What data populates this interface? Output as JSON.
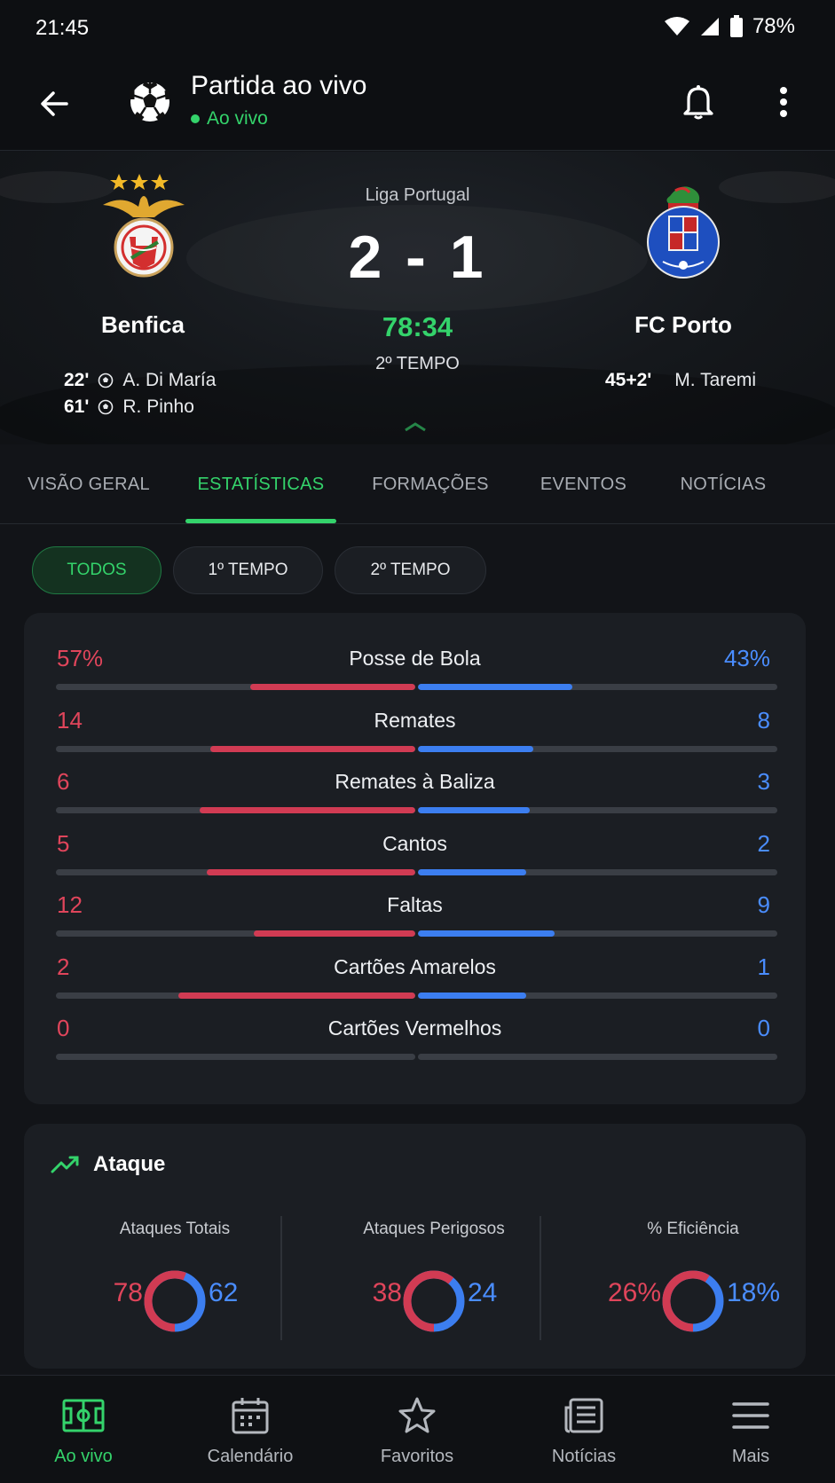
{
  "status_bar": {
    "time": "21:45",
    "battery": "78%"
  },
  "app_bar": {
    "title": "Partida ao vivo",
    "live_label": "Ao vivo"
  },
  "match": {
    "league": "Liga Portugal",
    "score": "2 - 1",
    "clock": "78:34",
    "period": "2º TEMPO",
    "home": {
      "name": "Benfica",
      "scorers": [
        {
          "minute": "22'",
          "player": "A. Di María"
        },
        {
          "minute": "61'",
          "player": "R. Pinho"
        }
      ]
    },
    "away": {
      "name": "FC Porto",
      "scorers": [
        {
          "minute": "45+2'",
          "player": "M. Taremi"
        }
      ]
    }
  },
  "tabs": [
    "VISÃO GERAL",
    "ESTATÍSTICAS",
    "FORMAÇÕES",
    "EVENTOS",
    "NOTÍCIAS"
  ],
  "active_tab": "ESTATÍSTICAS",
  "filters": [
    "TODOS",
    "1º TEMPO",
    "2º TEMPO"
  ],
  "active_filter": "TODOS",
  "stats": [
    {
      "label": "Posse de Bola",
      "home": "57%",
      "away": "43%",
      "home_share": 0.46,
      "away_share": 0.43
    },
    {
      "label": "Remates",
      "home": "14",
      "away": "8",
      "home_share": 0.57,
      "away_share": 0.32
    },
    {
      "label": "Remates à Baliza",
      "home": "6",
      "away": "3",
      "home_share": 0.6,
      "away_share": 0.31
    },
    {
      "label": "Cantos",
      "home": "5",
      "away": "2",
      "home_share": 0.58,
      "away_share": 0.3
    },
    {
      "label": "Faltas",
      "home": "12",
      "away": "9",
      "home_share": 0.45,
      "away_share": 0.38
    },
    {
      "label": "Cartões Amarelos",
      "home": "2",
      "away": "1",
      "home_share": 0.66,
      "away_share": 0.3
    },
    {
      "label": "Cartões Vermelhos",
      "home": "0",
      "away": "0",
      "home_share": 0,
      "away_share": 0
    }
  ],
  "attack": {
    "title": "Ataque",
    "metrics": [
      {
        "label": "Ataques Totais",
        "home": "78",
        "away": "62",
        "home_fraction": 0.56
      },
      {
        "label": "Ataques Perigosos",
        "home": "38",
        "away": "24",
        "home_fraction": 0.61
      },
      {
        "label": "% Eficiência",
        "home": "26%",
        "away": "18%",
        "home_fraction": 0.59
      }
    ]
  },
  "bottom_nav": [
    "Ao vivo",
    "Calendário",
    "Favoritos",
    "Notícias",
    "Mais"
  ],
  "colors": {
    "accent": "#34d36b",
    "home": "#d13b53",
    "away": "#3c7ef0",
    "background": "#121418"
  }
}
